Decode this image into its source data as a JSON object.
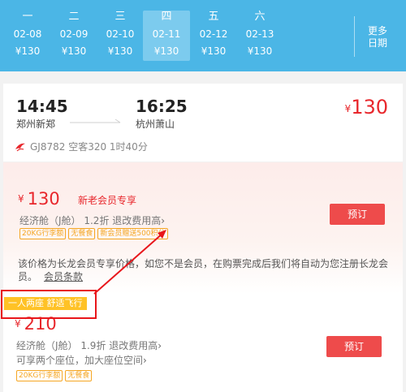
{
  "dates": [
    {
      "weekday": "一",
      "date": "02-08",
      "price": "¥130",
      "active": false
    },
    {
      "weekday": "二",
      "date": "02-09",
      "price": "¥130",
      "active": false
    },
    {
      "weekday": "三",
      "date": "02-10",
      "price": "¥130",
      "active": false
    },
    {
      "weekday": "四",
      "date": "02-11",
      "price": "¥130",
      "active": true
    },
    {
      "weekday": "五",
      "date": "02-12",
      "price": "¥130",
      "active": false
    },
    {
      "weekday": "六",
      "date": "02-13",
      "price": "¥130",
      "active": false
    }
  ],
  "more_dates": "更多日期",
  "flight": {
    "dep_time": "14:45",
    "dep_airport": "郑州新郑",
    "arr_time": "16:25",
    "arr_airport": "杭州萧山",
    "price_currency": "¥",
    "price": "130",
    "info": "GJ8782  空客320  1时40分"
  },
  "offer1": {
    "currency": "¥",
    "price": "130",
    "member_tag": "新老会员专享",
    "cabin": "经济舱（J舱） 1.2折  退改费用高",
    "tags": [
      "20KG行李额",
      "无餐食",
      "新会员赠送500积分"
    ],
    "book_label": "预订",
    "notice": "该价格为长龙会员专享价格，如您不是会员，在购票完成后我们将自动为您注册长龙会员。",
    "notice_link": "会员条款"
  },
  "offer2": {
    "badge": "一人两座 舒适飞行",
    "currency": "¥",
    "price": "210",
    "cabin": "经济舱（J舱） 1.9折  退改费用高",
    "desc": "可享两个座位，加大座位空间",
    "tags": [
      "20KG行李额",
      "无餐食"
    ],
    "book_label": "预订"
  },
  "colors": {
    "header_bg": "#4bb6e6",
    "price_red": "#e8272c",
    "book_button": "#ee4b4b",
    "tag_orange": "#f5a623",
    "badge_yellow": "#ffc226",
    "highlight_red": "#e8161b"
  },
  "icons": {
    "airline_logo": "airline-logo-icon",
    "arrow": "flight-arrow-icon",
    "chevron": "chevron-right-icon"
  }
}
